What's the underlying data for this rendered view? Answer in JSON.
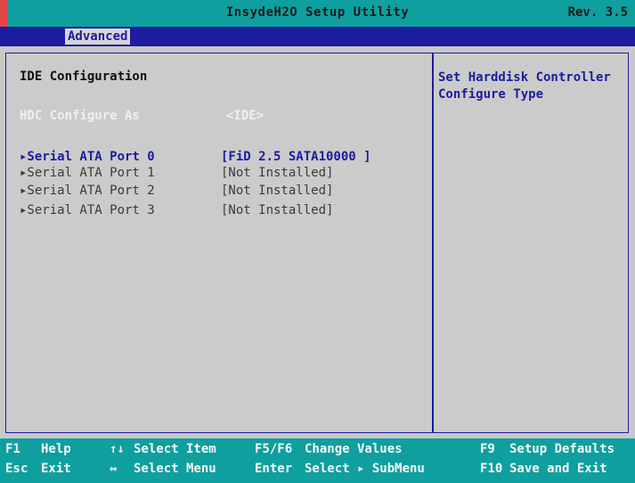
{
  "title_bar": {
    "title": "InsydeH2O Setup Utility",
    "revision": "Rev. 3.5"
  },
  "menu": {
    "active_tab": "Advanced"
  },
  "main": {
    "section_title": "IDE Configuration",
    "hdc": {
      "label": "HDC Configure As",
      "value": "<IDE>"
    },
    "ports": [
      {
        "label": "▸Serial ATA Port 0",
        "value": "[FiD 2.5 SATA10000   ]",
        "active": true
      },
      {
        "label": "▸Serial ATA Port 1",
        "value": "[Not Installed]",
        "active": false
      },
      {
        "label": "▸Serial ATA Port 2",
        "value": "[Not Installed]",
        "active": false
      },
      {
        "label": "▸Serial ATA Port 3",
        "value": "[Not Installed]",
        "active": false
      }
    ]
  },
  "help": {
    "text": "Set Harddisk Controller Configure Type"
  },
  "footer": {
    "rows": [
      [
        {
          "key": "F1",
          "desc": "Help"
        },
        {
          "key": "↑↓",
          "desc": "Select Item"
        },
        {
          "key": "F5/F6",
          "desc": "Change Values"
        },
        {
          "key": "F9",
          "desc": "Setup Defaults"
        }
      ],
      [
        {
          "key": "Esc",
          "desc": "Exit"
        },
        {
          "key": "↔",
          "desc": "Select Menu"
        },
        {
          "key": "Enter",
          "desc": "Select ▸ SubMenu"
        },
        {
          "key": "F10",
          "desc": "Save and Exit"
        }
      ]
    ]
  },
  "colors": {
    "titlebar": "#0f9f9f",
    "menubar": "#1c1ca0",
    "panel_bg": "#cbcbcb",
    "active_text": "#1c1ca0",
    "red_marker": "#e24646"
  }
}
